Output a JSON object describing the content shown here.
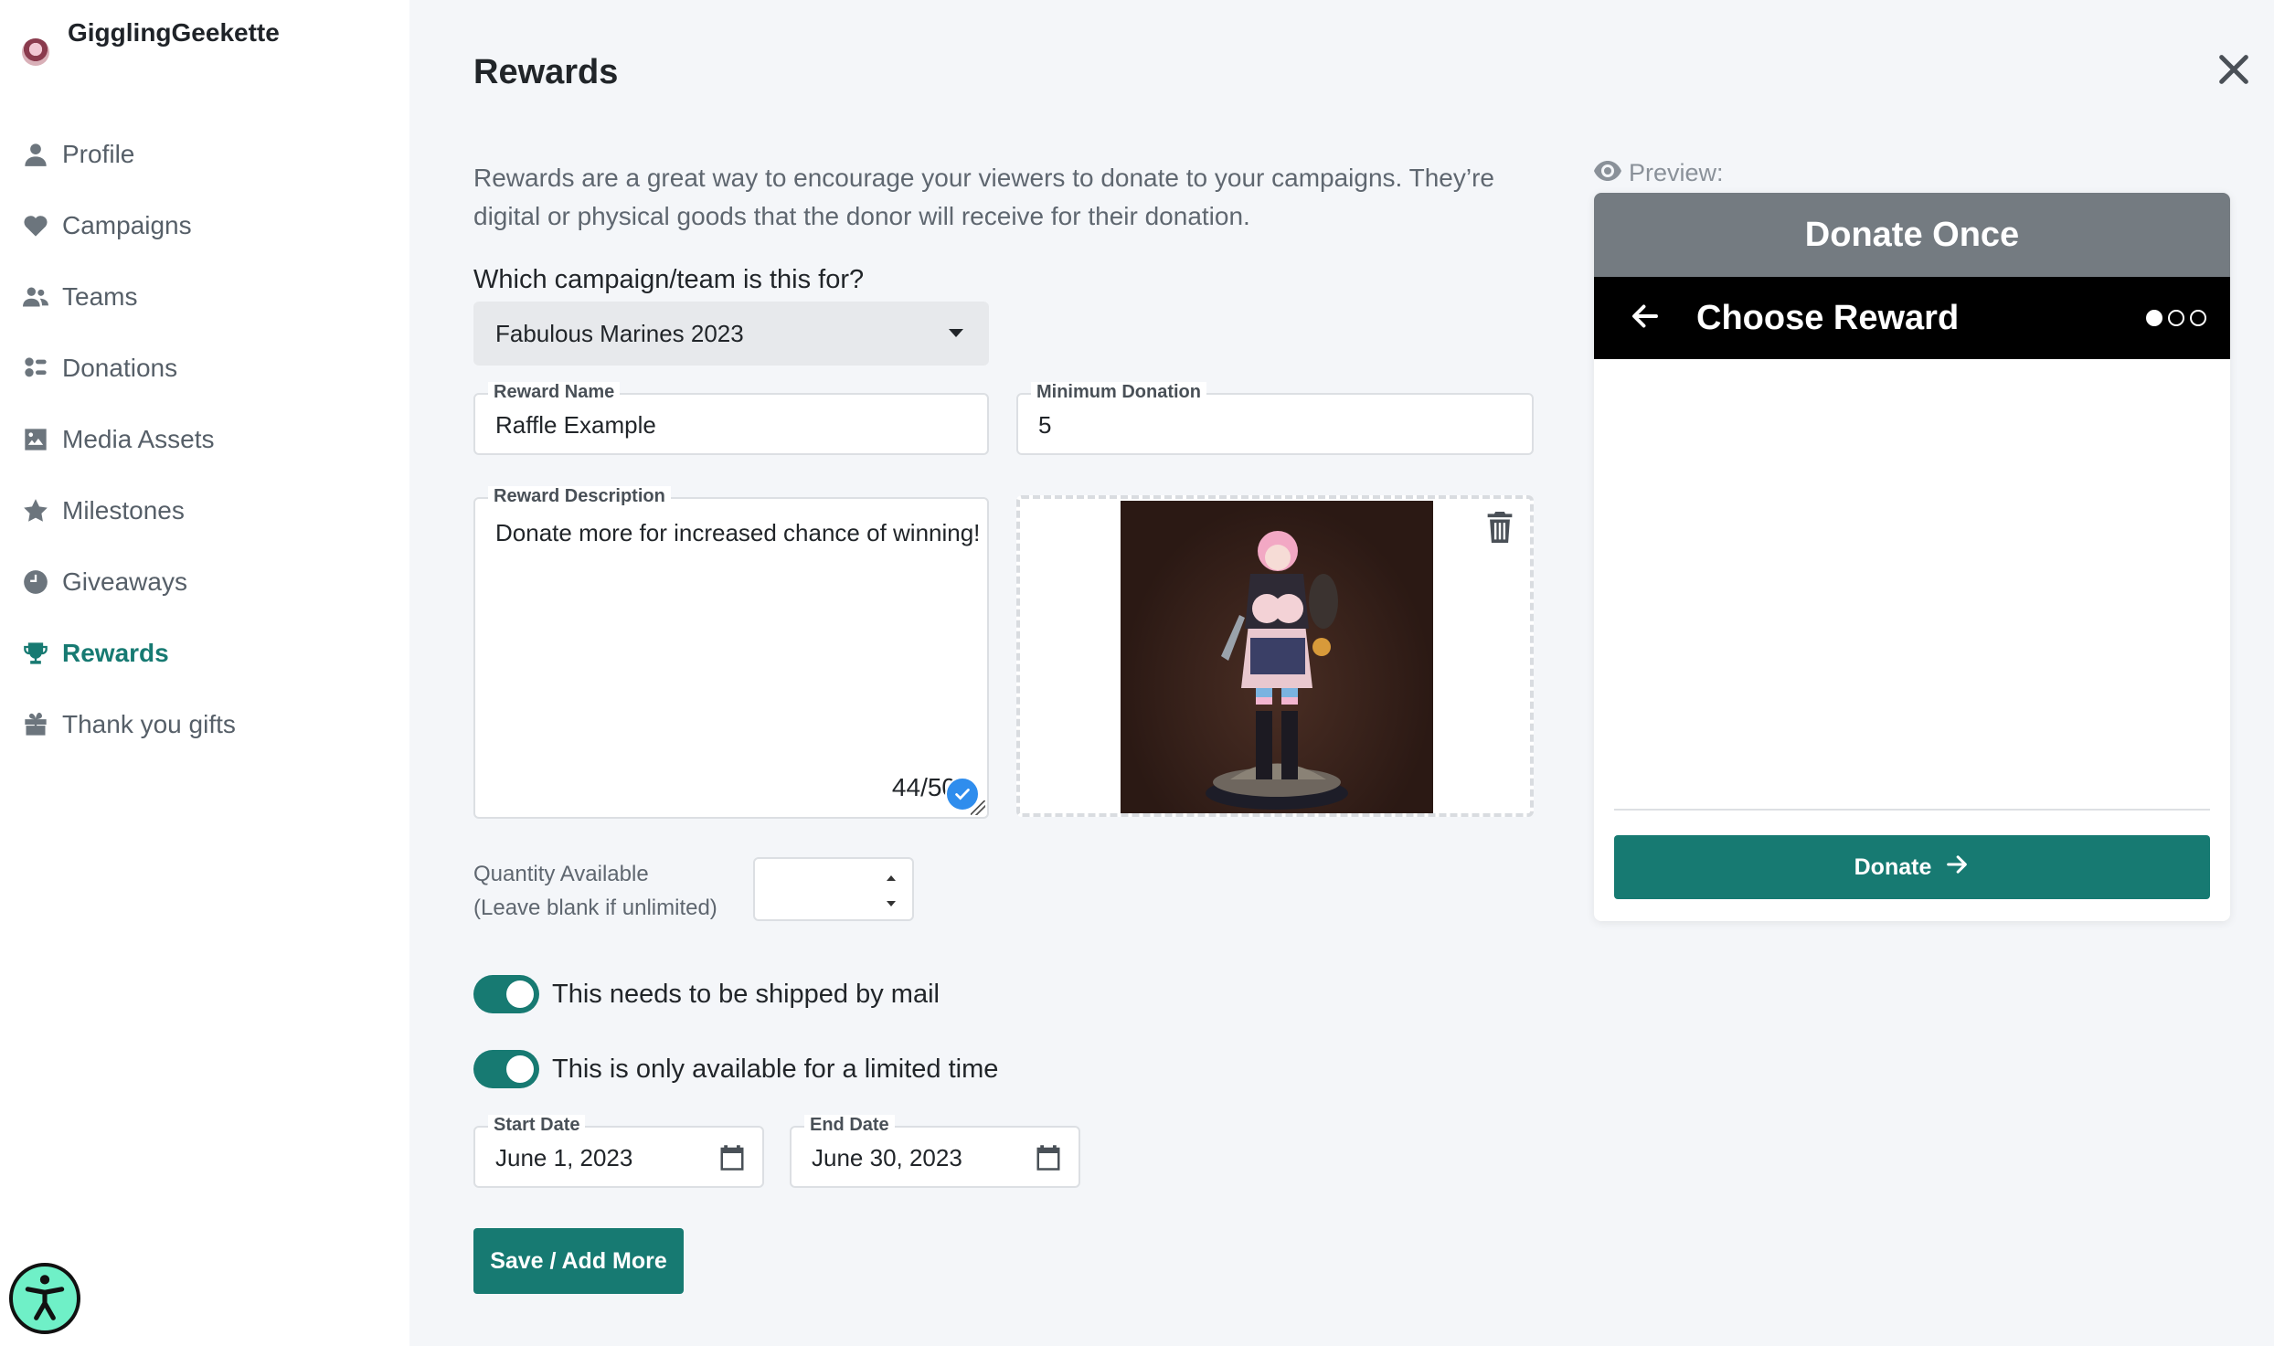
{
  "user": {
    "name": "GigglingGeekette"
  },
  "sidebar": {
    "items": [
      {
        "label": "Profile",
        "icon": "user-icon",
        "active": false
      },
      {
        "label": "Campaigns",
        "icon": "heart-icon",
        "active": false
      },
      {
        "label": "Teams",
        "icon": "users-icon",
        "active": false
      },
      {
        "label": "Donations",
        "icon": "donations-icon",
        "active": false
      },
      {
        "label": "Media Assets",
        "icon": "image-icon",
        "active": false
      },
      {
        "label": "Milestones",
        "icon": "star-icon",
        "active": false
      },
      {
        "label": "Giveaways",
        "icon": "clock-icon",
        "active": false
      },
      {
        "label": "Rewards",
        "icon": "trophy-icon",
        "active": true
      },
      {
        "label": "Thank you gifts",
        "icon": "gift-icon",
        "active": false
      }
    ]
  },
  "main": {
    "title": "Rewards",
    "intro": "Rewards are a great way to encourage your viewers to donate to your campaigns. They’re digital or physical goods that the donor will receive for their donation.",
    "campaign_question": "Which campaign/team is this for?",
    "campaign_selected": "Fabulous Marines 2023",
    "reward_name": {
      "label": "Reward Name",
      "value": "Raffle Example"
    },
    "min_donation": {
      "label": "Minimum Donation",
      "value": "5"
    },
    "description": {
      "label": "Reward Description",
      "value": "Donate more for increased chance of winning!",
      "counter": "44/50"
    },
    "quantity": {
      "label_line1": "Quantity Available",
      "label_line2": "(Leave blank if unlimited)",
      "value": ""
    },
    "shipped_toggle": {
      "label": "This needs to be shipped by mail",
      "on": true
    },
    "limited_toggle": {
      "label": "This is only available for a limited time",
      "on": true
    },
    "start_date": {
      "label": "Start Date",
      "value": "June 1, 2023"
    },
    "end_date": {
      "label": "End Date",
      "value": "June 30, 2023"
    },
    "save_label": "Save / Add More"
  },
  "preview": {
    "label": "Preview:",
    "header": "Donate Once",
    "step_title": "Choose Reward",
    "step_dots": {
      "total": 3,
      "current": 1
    },
    "donate_label": "Donate"
  },
  "colors": {
    "accent": "#177a72",
    "sidebar_bg": "#ffffff",
    "main_bg": "#f4f6f9",
    "preview_header": "#747b81"
  }
}
